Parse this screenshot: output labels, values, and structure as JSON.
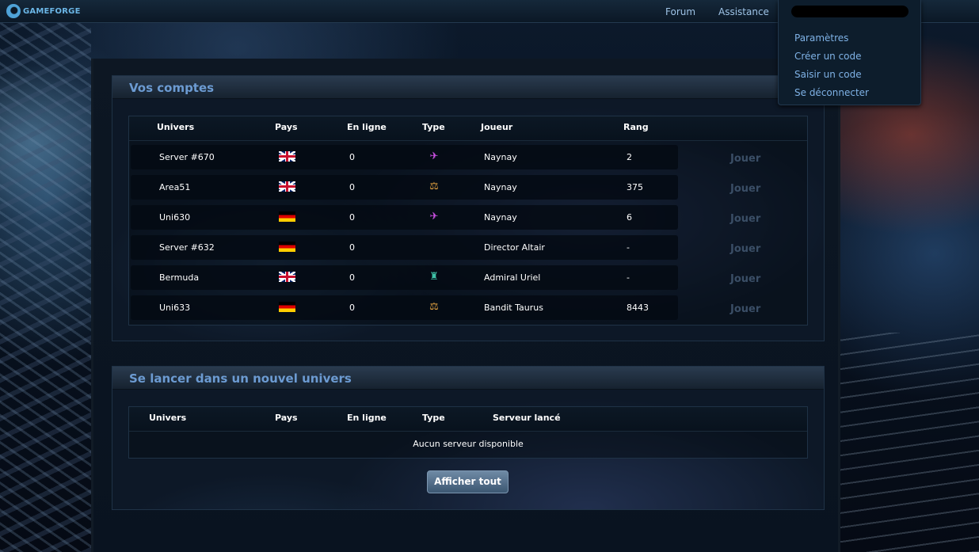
{
  "topbar": {
    "logo_text": "GAMEFORGE",
    "links": {
      "forum": "Forum",
      "assistance": "Assistance"
    }
  },
  "user_menu": {
    "items": [
      "Paramètres",
      "Créer un code",
      "Saisir un code",
      "Se déconnecter"
    ]
  },
  "accounts": {
    "title": "Vos comptes",
    "headers": {
      "univers": "Univers",
      "pays": "Pays",
      "en_ligne": "En ligne",
      "type": "Type",
      "joueur": "Joueur",
      "rang": "Rang"
    },
    "play_label": "Jouer",
    "rows": [
      {
        "univers": "Server #670",
        "pays": "gb",
        "en_ligne": "0",
        "type": "ship-icon",
        "joueur": "Naynay",
        "rang": "2"
      },
      {
        "univers": "Area51",
        "pays": "gb",
        "en_ligne": "0",
        "type": "scales-icon",
        "joueur": "Naynay",
        "rang": "375"
      },
      {
        "univers": "Uni630",
        "pays": "de",
        "en_ligne": "0",
        "type": "ship-icon",
        "joueur": "Naynay",
        "rang": "6"
      },
      {
        "univers": "Server #632",
        "pays": "de",
        "en_ligne": "0",
        "type": "",
        "joueur": "Director Altair",
        "rang": "-"
      },
      {
        "univers": "Bermuda",
        "pays": "gb",
        "en_ligne": "0",
        "type": "station-icon",
        "joueur": "Admiral Uriel",
        "rang": "-"
      },
      {
        "univers": "Uni633",
        "pays": "de",
        "en_ligne": "0",
        "type": "scales-icon",
        "joueur": "Bandit Taurus",
        "rang": "8443"
      }
    ]
  },
  "new_universe": {
    "title": "Se lancer dans un nouvel univers",
    "headers": {
      "univers": "Univers",
      "pays": "Pays",
      "en_ligne": "En ligne",
      "type": "Type",
      "serveur": "Serveur lancé"
    },
    "empty_message": "Aucun serveur disponible",
    "button_label": "Afficher tout"
  },
  "colors": {
    "section_title": "#6c9bd2",
    "menu_link": "#7fb2e6",
    "play_disabled": "#3a4e66",
    "ship_type": "#c84fe0",
    "scales_type": "#e0a040",
    "station_type": "#3fc2a8"
  }
}
